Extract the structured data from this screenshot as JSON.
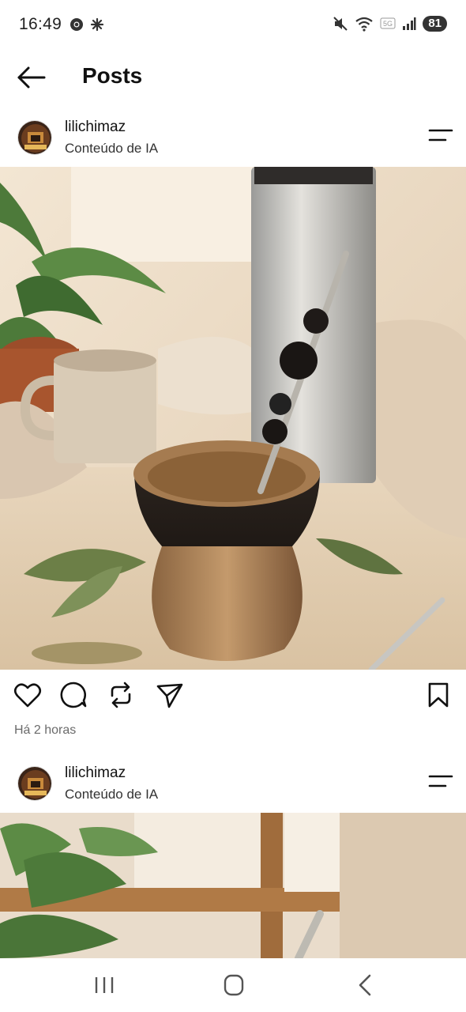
{
  "status_bar": {
    "time": "16:49",
    "icons_left": [
      "chrome-icon",
      "pinwheel-icon"
    ],
    "icons_right": [
      "mute-icon",
      "wifi-icon",
      "5g-icon",
      "signal-icon"
    ],
    "battery": "81"
  },
  "header": {
    "title": "Posts"
  },
  "posts": [
    {
      "username": "lilichimaz",
      "subtitle": "Conteúdo de IA",
      "timestamp": "Há 2 horas"
    },
    {
      "username": "lilichimaz",
      "subtitle": "Conteúdo de IA"
    }
  ],
  "actions": [
    "heart-icon",
    "comment-icon",
    "repost-icon",
    "send-icon",
    "bookmark-icon"
  ],
  "nav": [
    "recent-apps-icon",
    "home-icon",
    "back-icon"
  ]
}
